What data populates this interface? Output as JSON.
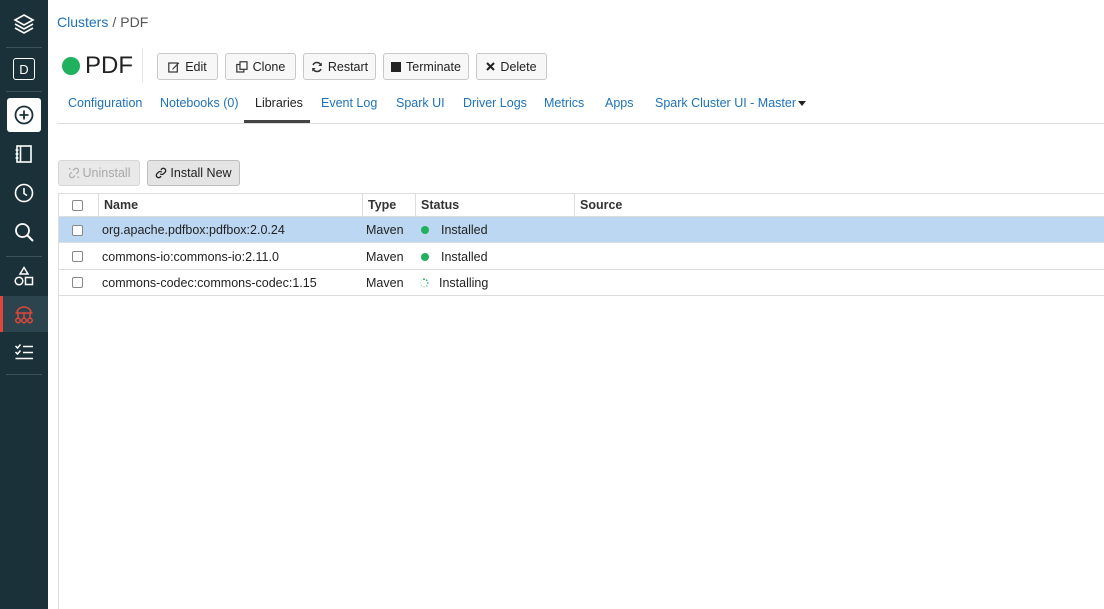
{
  "breadcrumb": {
    "parent": "Clusters",
    "separator": "/",
    "current": "PDF"
  },
  "cluster": {
    "name": "PDF",
    "status_color": "#1fb15e"
  },
  "actions": [
    {
      "label": "Edit",
      "icon": "edit-icon"
    },
    {
      "label": "Clone",
      "icon": "clone-icon"
    },
    {
      "label": "Restart",
      "icon": "refresh-icon"
    },
    {
      "label": "Terminate",
      "icon": "stop-icon"
    },
    {
      "label": "Delete",
      "icon": "close-icon"
    }
  ],
  "tabs": [
    {
      "label": "Configuration"
    },
    {
      "label": "Notebooks (0)"
    },
    {
      "label": "Libraries",
      "active": true
    },
    {
      "label": "Event Log"
    },
    {
      "label": "Spark UI"
    },
    {
      "label": "Driver Logs"
    },
    {
      "label": "Metrics"
    },
    {
      "label": "Apps"
    },
    {
      "label": "Spark Cluster UI - Master"
    }
  ],
  "toolbar": {
    "uninstall_label": "Uninstall",
    "install_label": "Install New"
  },
  "table": {
    "columns": [
      "Name",
      "Type",
      "Status",
      "Source"
    ],
    "rows": [
      {
        "name": "org.apache.pdfbox:pdfbox:2.0.24",
        "type": "Maven",
        "status": "Installed",
        "source": "",
        "selected": true
      },
      {
        "name": "commons-io:commons-io:2.11.0",
        "type": "Maven",
        "status": "Installed",
        "source": ""
      },
      {
        "name": "commons-codec:commons-codec:1.15",
        "type": "Maven",
        "status": "Installing",
        "source": ""
      }
    ]
  },
  "sidebar": {
    "items": [
      {
        "icon": "layers-icon"
      },
      {
        "icon": "workspace-d-icon",
        "label": "D"
      },
      {
        "icon": "create-plus-icon"
      },
      {
        "icon": "notebook-icon"
      },
      {
        "icon": "recents-clock-icon"
      },
      {
        "icon": "search-icon"
      },
      {
        "icon": "shapes-icon"
      },
      {
        "icon": "compute-cluster-icon",
        "active": true
      },
      {
        "icon": "jobs-list-icon"
      }
    ]
  },
  "colors": {
    "sidebar": "#1b3139",
    "link": "#1d72b8",
    "accent": "#e0463a",
    "selected_row": "#bcd7f1",
    "success": "#1fb15e"
  }
}
